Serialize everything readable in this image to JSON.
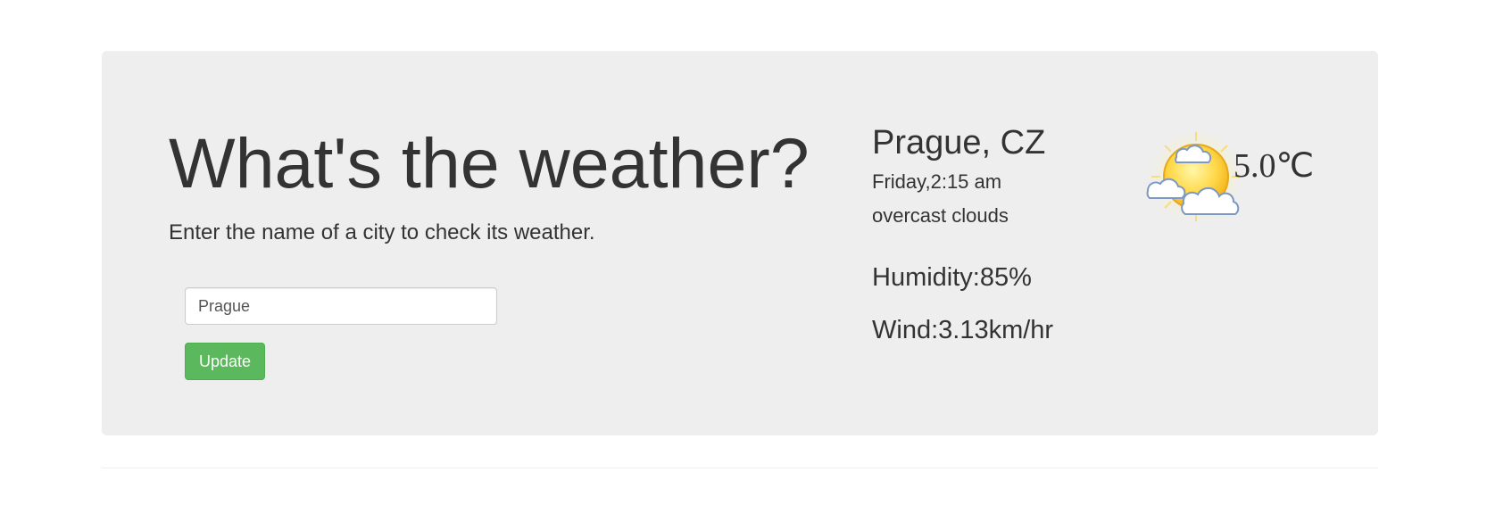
{
  "hero": {
    "title": "What's the weather?",
    "subtitle": "Enter the name of a city to check its weather."
  },
  "form": {
    "city_value": "Prague",
    "update_label": "Update"
  },
  "weather": {
    "city": "Prague, CZ",
    "datetime": "Friday,2:15 am",
    "description": "overcast clouds",
    "humidity": "Humidity:85%",
    "wind": "Wind:3.13km/hr",
    "temperature": "5.0℃",
    "icon": "partly-cloudy-sun-icon"
  },
  "colors": {
    "jumbotron_bg": "#eeeeee",
    "button_green": "#5cb85c",
    "text": "#333333"
  }
}
